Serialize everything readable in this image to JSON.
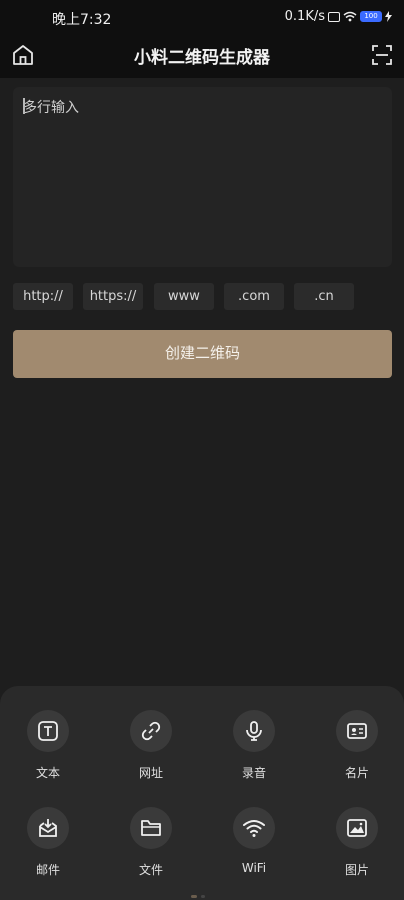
{
  "status_bar": {
    "time": "晚上7:32",
    "network_speed": "0.1K/s",
    "battery": "100"
  },
  "header": {
    "title": "小料二维码生成器",
    "home_icon": "home-icon",
    "scan_icon": "scan-icon"
  },
  "input": {
    "placeholder": "多行输入",
    "value": ""
  },
  "chips": [
    {
      "label": "http://"
    },
    {
      "label": "https://"
    },
    {
      "label": "www"
    },
    {
      "label": ".com"
    },
    {
      "label": ".cn"
    }
  ],
  "create_button": {
    "label": "创建二维码"
  },
  "types": [
    {
      "label": "文本",
      "icon": "text-icon"
    },
    {
      "label": "网址",
      "icon": "link-icon"
    },
    {
      "label": "录音",
      "icon": "microphone-icon"
    },
    {
      "label": "名片",
      "icon": "contact-card-icon"
    },
    {
      "label": "邮件",
      "icon": "mail-icon"
    },
    {
      "label": "文件",
      "icon": "folder-icon"
    },
    {
      "label": "WiFi",
      "icon": "wifi-icon"
    },
    {
      "label": "图片",
      "icon": "image-icon"
    }
  ],
  "colors": {
    "accent": "#a18a6f",
    "background": "#1e1e1e",
    "panel": "#2a2a2a"
  }
}
